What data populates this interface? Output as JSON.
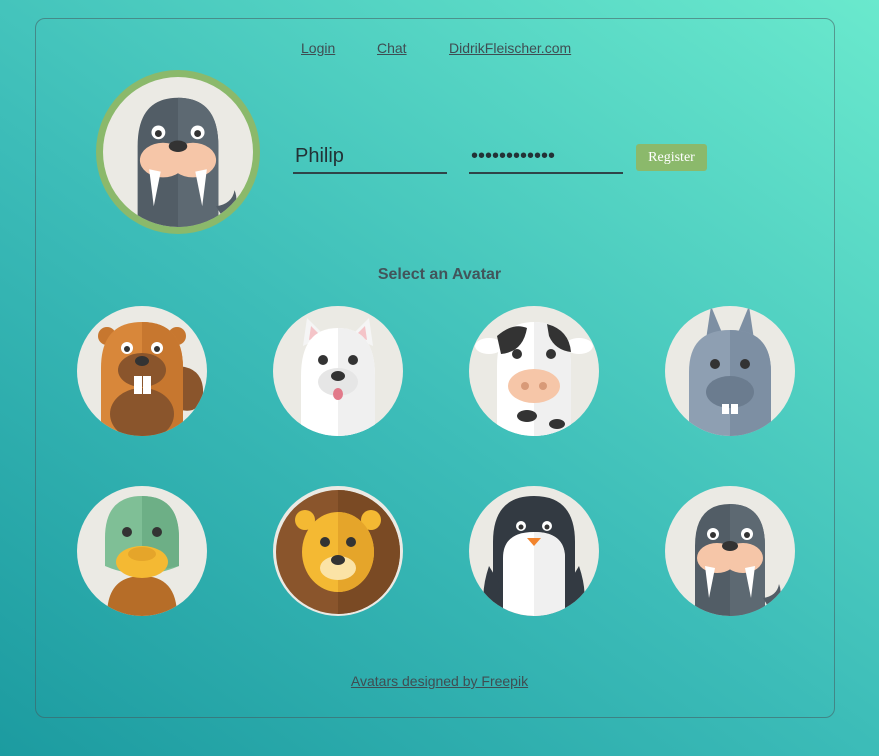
{
  "nav": {
    "login": "Login",
    "chat": "Chat",
    "site": "DidrikFleischer.com"
  },
  "register_form": {
    "username_value": "Philip",
    "password_value": "••••••••••••",
    "register_label": "Register",
    "selected_avatar": "walrus"
  },
  "avatar_section": {
    "title": "Select an Avatar",
    "avatars": [
      "beaver",
      "westie-dog",
      "cow",
      "donkey",
      "duck",
      "lion",
      "penguin",
      "walrus"
    ]
  },
  "footer": {
    "credit": "Avatars designed by Freepik"
  },
  "colors": {
    "accent_green": "#8bb96b",
    "avatar_bg": "#ebeae4",
    "text": "#3f4d52"
  }
}
